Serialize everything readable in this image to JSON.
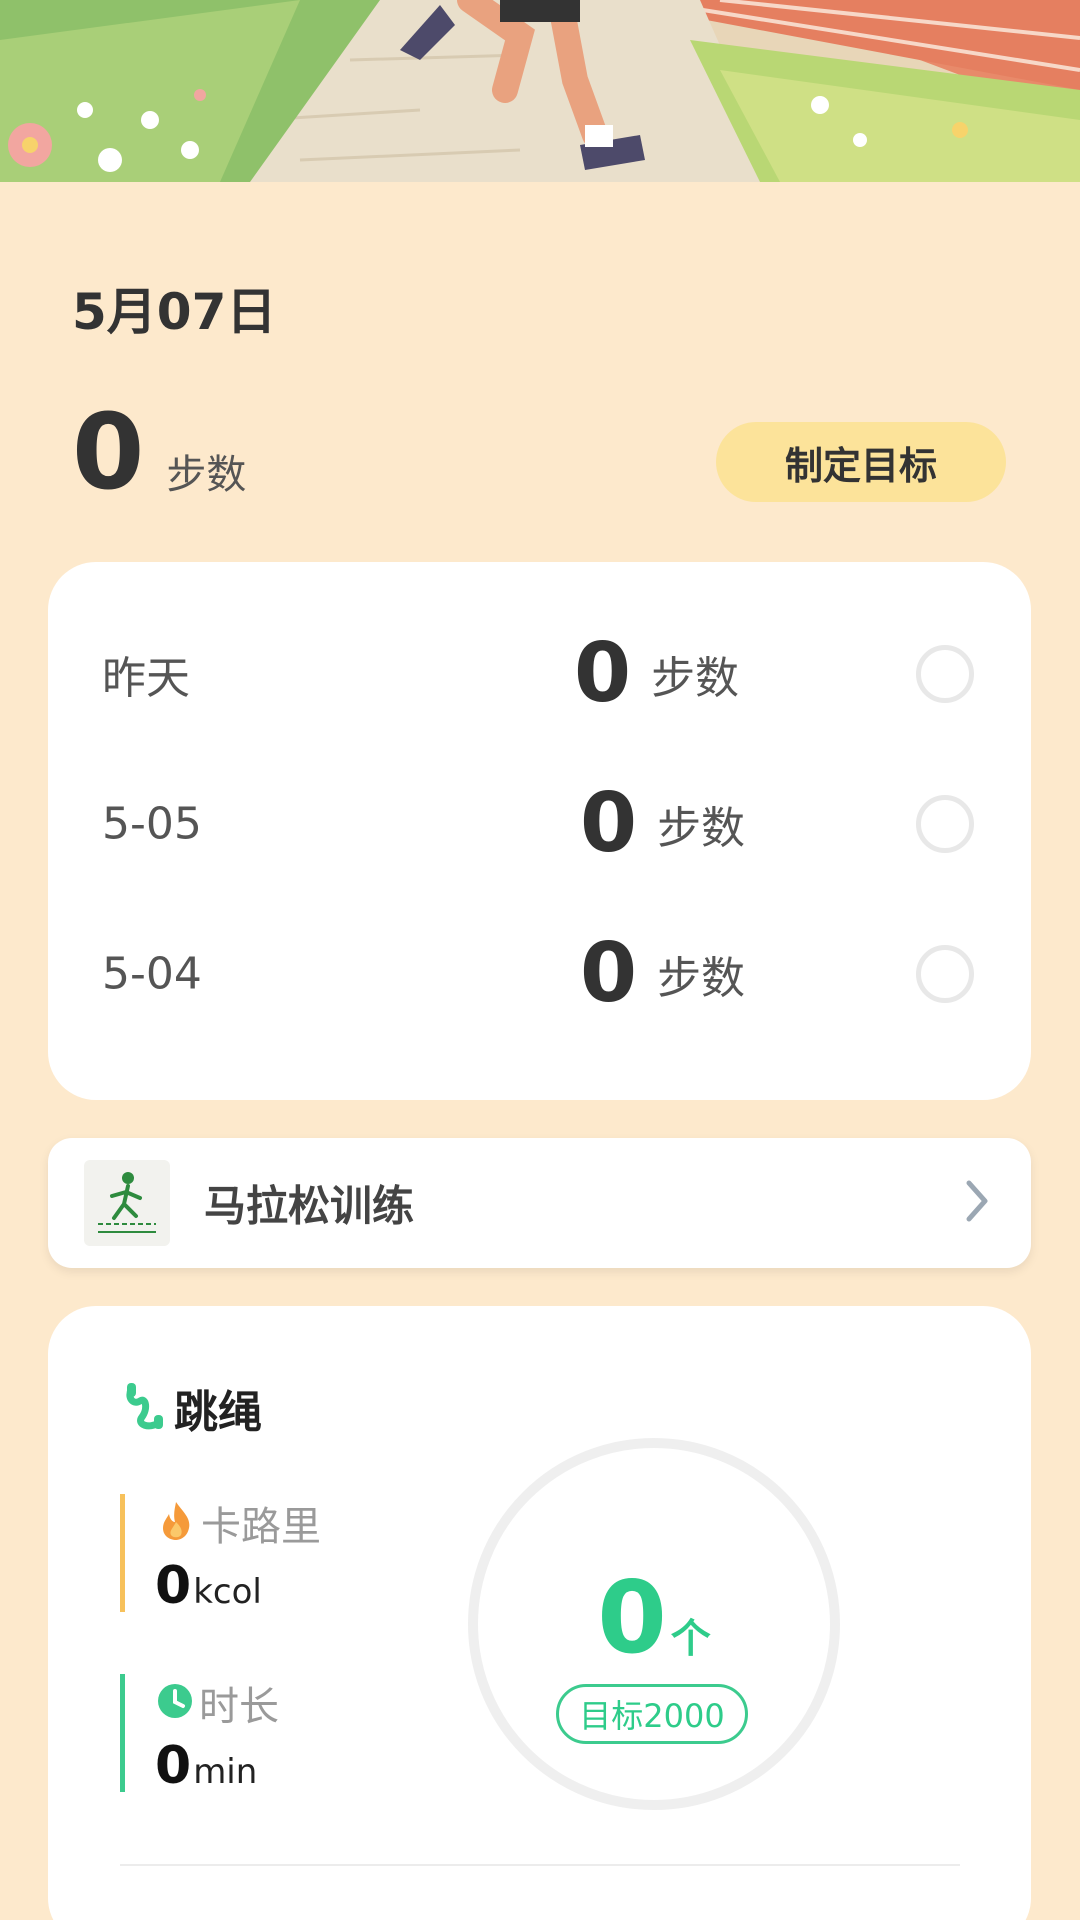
{
  "header": {
    "date": "5月07日",
    "today_steps": "0",
    "steps_unit": "步数",
    "set_goal_label": "制定目标"
  },
  "history": [
    {
      "label": "昨天",
      "steps": "0",
      "unit": "步数"
    },
    {
      "label": "5-05",
      "steps": "0",
      "unit": "步数"
    },
    {
      "label": "5-04",
      "steps": "0",
      "unit": "步数"
    }
  ],
  "marathon": {
    "icon": "runner-icon",
    "label": "马拉松训练"
  },
  "jump_rope": {
    "title": "跳绳",
    "calories": {
      "label": "卡路里",
      "value": "0",
      "unit": "kcol"
    },
    "duration": {
      "label": "时长",
      "value": "0",
      "unit": "min"
    },
    "count": "0",
    "count_unit": "个",
    "goal": "目标2000"
  },
  "colors": {
    "page_bg": "#FDE9CC",
    "goal_button": "#FCE39A",
    "accent_green": "#2ECC8A",
    "accent_orange": "#F7C15B"
  }
}
